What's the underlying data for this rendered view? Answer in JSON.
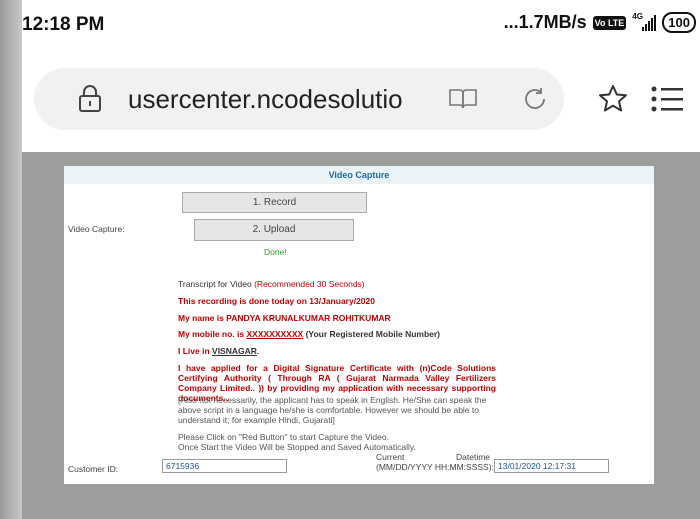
{
  "status": {
    "time": "12:18 PM",
    "speed": "...1.7MB/s",
    "volte": "Vo LTE",
    "network": "4G",
    "battery": "100"
  },
  "browser": {
    "url": "usercenter.ncodesolutio",
    "icons": [
      "lock-icon",
      "reader-mode-icon",
      "reload-icon",
      "star-icon",
      "menu-icon"
    ]
  },
  "form": {
    "title": "Video Capture",
    "record_label": "1. Record",
    "upload_label": "2. Upload",
    "video_capture_label": "Video Capture:",
    "done": "Done!",
    "transcript_label": "Transcript for Video",
    "transcript_note": "(Recommended 30 Seconds)",
    "line1": "This recording is done today on 13/January/2020",
    "line2": "My name is PANDYA KRUNALKUMAR ROHITKUMAR",
    "line3_prefix": "My mobile no. is",
    "line3_number": "XXXXXXXXXX",
    "line3_suffix": "(Your Registered Mobile Number)",
    "line4_prefix": "I Live in",
    "line4_city": "VISNAGAR",
    "line4_end": ".",
    "para1": "I have applied for a Digital Signature Certificate with (n)Code Solutions Certifying Authority ( Through RA ( Gujarat Narmada Valley Fertilizers Company Limited.. )) by providing my application with necessary supporting documents..",
    "para2": "[Also not necessarily, the applicant has to speak in English. He/She can speak the above script in a language he/she is comfortable. However we should be able to understand it; for example Hindi, Gujarati]",
    "instr1": "Please Click on \"Red Button\" to start Capture the Video.",
    "instr2": "Once Start the Video Will be Stopped and Saved Automatically.",
    "customer_id_label": "Customer ID:",
    "customer_id": "6715936",
    "datetime_label_1": "Current",
    "datetime_label_2": "Datetime",
    "datetime_label_3": "(MM/DD/YYYY HH:MM:SSSS):",
    "datetime_value": "13/01/2020 12:17:31"
  },
  "colors": {
    "accent": "#1d6aa0",
    "red": "#c00000",
    "done": "#2a9d2a"
  }
}
